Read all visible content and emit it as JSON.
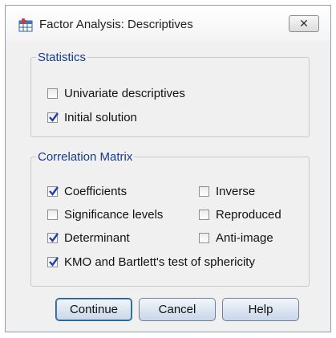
{
  "dialog": {
    "title": "Factor Analysis: Descriptives",
    "close_symbol": "✕"
  },
  "statistics": {
    "legend": "Statistics",
    "items": [
      {
        "label": "Univariate descriptives",
        "checked": false
      },
      {
        "label": "Initial solution",
        "checked": true
      }
    ]
  },
  "correlation_matrix": {
    "legend": "Correlation Matrix",
    "items": [
      {
        "label": "Coefficients",
        "checked": true
      },
      {
        "label": "Inverse",
        "checked": false
      },
      {
        "label": "Significance levels",
        "checked": false
      },
      {
        "label": "Reproduced",
        "checked": false
      },
      {
        "label": "Determinant",
        "checked": true
      },
      {
        "label": "Anti-image",
        "checked": false
      },
      {
        "label": "KMO and Bartlett's test of sphericity",
        "checked": true
      }
    ]
  },
  "buttons": {
    "continue": "Continue",
    "cancel": "Cancel",
    "help": "Help"
  },
  "colors": {
    "legend": "#1a3a8f",
    "check": "#1f3fa8",
    "button_border": "#6f7f98"
  },
  "icons": {
    "app": "spss-factor-icon",
    "check": "checkmark-icon"
  }
}
